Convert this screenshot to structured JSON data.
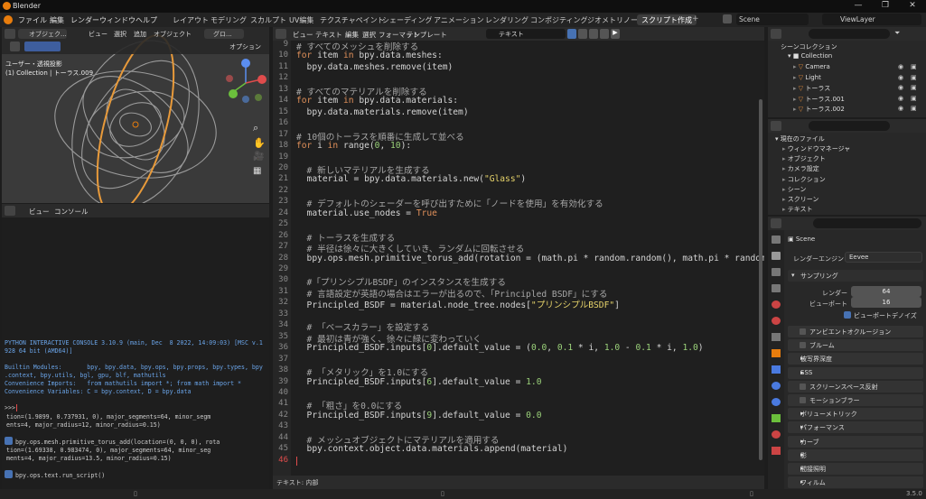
{
  "window": {
    "title": "Blender",
    "version": "3.5.0"
  },
  "menu": [
    "ファイル",
    "編集",
    "レンダー",
    "ウィンドウ",
    "ヘルプ"
  ],
  "workspaces": [
    "レイアウト",
    "モデリング",
    "スカルプト",
    "UV編集",
    "テクスチャペイント",
    "シェーディング",
    "アニメーション",
    "レンダリング",
    "コンポジティング",
    "ジオメトリノード",
    "スクリプト作成"
  ],
  "scene_selector": {
    "scene": "Scene",
    "viewlayer": "ViewLayer"
  },
  "viewport": {
    "mode": "オブジェク...",
    "menus": [
      "ビュー",
      "選択",
      "追加",
      "オブジェクト"
    ],
    "transform": "グロ...",
    "options": "オプション",
    "overlay_title": "ユーザー・透視投影",
    "overlay_sub": "(1) Collection | トーラス.009"
  },
  "console": {
    "menus": [
      "ビュー",
      "コンソール"
    ],
    "lines": [
      "PYTHON INTERACTIVE CONSOLE 3.10.9 (main, Dec  8 2022, 14:09:03) [MSC v.1",
      "928 64 bit (AMD64)]",
      "",
      "Builtin Modules:       bpy, bpy.data, bpy.ops, bpy.props, bpy.types, bpy",
      ".context, bpy.utils, bgl, gpu, blf, mathutils",
      "Convenience Imports:   from mathutils import *; from math import *",
      "Convenience Variables: C = bpy.context, D = bpy.data",
      "",
      ">>> "
    ],
    "history": [
      "tion=(1.9899, 0.737931, 0), major_segments=64, minor_segm",
      "ents=4, major_radius=12, minor_radius=0.15)",
      "bpy.ops.mesh.primitive_torus_add(location=(0, 0, 0), rota",
      "tion=(1.69338, 0.983474, 0), major_segments=64, minor_seg",
      "ments=4, major_radius=13.5, minor_radius=0.15)",
      "bpy.ops.text.run_script()"
    ]
  },
  "editor": {
    "menus": [
      "ビュー",
      "テキスト",
      "編集",
      "選択",
      "フォーマット",
      "テンプレート"
    ],
    "filename": "テキスト",
    "footer": "テキスト: 内部",
    "lines": [
      {
        "n": "9",
        "segs": [
          [
            "cm",
            "# すべてのメッシュを削除する"
          ]
        ]
      },
      {
        "n": "10",
        "segs": [
          [
            "kw",
            "for"
          ],
          [
            "",
            " item "
          ],
          [
            "kw",
            "in"
          ],
          [
            "",
            " bpy.data.meshes:"
          ]
        ]
      },
      {
        "n": "11",
        "segs": [
          [
            "",
            "  bpy.data.meshes.remove(item)"
          ]
        ]
      },
      {
        "n": "12",
        "segs": []
      },
      {
        "n": "13",
        "segs": [
          [
            "cm",
            "# すべてのマテリアルを削除する"
          ]
        ]
      },
      {
        "n": "14",
        "segs": [
          [
            "kw",
            "for"
          ],
          [
            "",
            " item "
          ],
          [
            "kw",
            "in"
          ],
          [
            "",
            " bpy.data.materials:"
          ]
        ]
      },
      {
        "n": "15",
        "segs": [
          [
            "",
            "  bpy.data.materials.remove(item)"
          ]
        ]
      },
      {
        "n": "16",
        "segs": []
      },
      {
        "n": "17",
        "segs": [
          [
            "cm",
            "# 10個のトーラスを順番に生成して並べる"
          ]
        ]
      },
      {
        "n": "18",
        "segs": [
          [
            "kw",
            "for"
          ],
          [
            "",
            " i "
          ],
          [
            "kw",
            "in"
          ],
          [
            "",
            " range("
          ],
          [
            "nu",
            "0"
          ],
          [
            "",
            ", "
          ],
          [
            "nu",
            "10"
          ],
          [
            "",
            "):"
          ]
        ]
      },
      {
        "n": "19",
        "segs": []
      },
      {
        "n": "20",
        "segs": [
          [
            "cm",
            "  # 新しいマテリアルを生成する"
          ]
        ]
      },
      {
        "n": "21",
        "segs": [
          [
            "",
            "  material = bpy.data.materials.new("
          ],
          [
            "st",
            "\"Glass\""
          ],
          [
            "",
            ")"
          ]
        ]
      },
      {
        "n": "22",
        "segs": []
      },
      {
        "n": "23",
        "segs": [
          [
            "cm",
            "  # デフォルトのシェーダーを呼び出すために「ノードを使用」を有効化する"
          ]
        ]
      },
      {
        "n": "24",
        "segs": [
          [
            "",
            "  material.use_nodes = "
          ],
          [
            "kw",
            "True"
          ]
        ]
      },
      {
        "n": "25",
        "segs": []
      },
      {
        "n": "26",
        "segs": [
          [
            "cm",
            "  # トーラスを生成する"
          ]
        ]
      },
      {
        "n": "27",
        "segs": [
          [
            "cm",
            "  # 半径は徐々に大きくしていき、ランダムに回転させる"
          ]
        ]
      },
      {
        "n": "28",
        "segs": [
          [
            "",
            "  bpy.ops.mesh.primitive_torus_add(rotation = (math.pi * random.random(), math.pi * random."
          ]
        ]
      },
      {
        "n": "29",
        "segs": []
      },
      {
        "n": "30",
        "segs": [
          [
            "cm",
            "  #「プリンシプルBSDF」のインスタンスを生成する"
          ]
        ]
      },
      {
        "n": "31",
        "segs": [
          [
            "cm",
            "  # 言語設定が英語の場合はエラーが出るので、「Principled BSDF」にする"
          ]
        ]
      },
      {
        "n": "32",
        "segs": [
          [
            "",
            "  Principled_BSDF = material.node_tree.nodes["
          ],
          [
            "st",
            "\"プリンシプルBSDF\""
          ],
          [
            "",
            "]"
          ]
        ]
      },
      {
        "n": "33",
        "segs": []
      },
      {
        "n": "34",
        "segs": [
          [
            "cm",
            "  # 「ベースカラー」を設定する"
          ]
        ]
      },
      {
        "n": "35",
        "segs": [
          [
            "cm",
            "  # 最初は青が強く、徐々に緑に変わっていく"
          ]
        ]
      },
      {
        "n": "36",
        "segs": [
          [
            "",
            "  Principled_BSDF.inputs["
          ],
          [
            "nu",
            "0"
          ],
          [
            "",
            "].default_value = ("
          ],
          [
            "nu",
            "0.0"
          ],
          [
            "",
            ", "
          ],
          [
            "nu",
            "0.1"
          ],
          [
            "",
            " * i, "
          ],
          [
            "nu",
            "1.0"
          ],
          [
            "",
            " - "
          ],
          [
            "nu",
            "0.1"
          ],
          [
            "",
            " * i, "
          ],
          [
            "nu",
            "1.0"
          ],
          [
            "",
            ")"
          ]
        ]
      },
      {
        "n": "37",
        "segs": []
      },
      {
        "n": "38",
        "segs": [
          [
            "cm",
            "  # 「メタリック」を1.0にする"
          ]
        ]
      },
      {
        "n": "39",
        "segs": [
          [
            "",
            "  Principled_BSDF.inputs["
          ],
          [
            "nu",
            "6"
          ],
          [
            "",
            "].default_value = "
          ],
          [
            "nu",
            "1.0"
          ]
        ]
      },
      {
        "n": "40",
        "segs": []
      },
      {
        "n": "41",
        "segs": [
          [
            "cm",
            "  # 「粗さ」を0.0にする"
          ]
        ]
      },
      {
        "n": "42",
        "segs": [
          [
            "",
            "  Principled_BSDF.inputs["
          ],
          [
            "nu",
            "9"
          ],
          [
            "",
            "].default_value = "
          ],
          [
            "nu",
            "0.0"
          ]
        ]
      },
      {
        "n": "43",
        "segs": []
      },
      {
        "n": "44",
        "segs": [
          [
            "cm",
            "  # メッシュオブジェクトにマテリアルを適用する"
          ]
        ]
      },
      {
        "n": "45",
        "segs": [
          [
            "",
            "  bpy.context.object.data.materials.append(material)"
          ]
        ]
      },
      {
        "n": "46",
        "segs": []
      }
    ]
  },
  "outliner": {
    "root": "シーンコレクション",
    "collection": "Collection",
    "items": [
      "Camera",
      "Light",
      "トーラス",
      "トーラス.001",
      "トーラス.002"
    ]
  },
  "fileview": {
    "root": "現在のファイル",
    "items": [
      "ウィンドウマネージャ",
      "オブジェクト",
      "カメラ設定",
      "コレクション",
      "シーン",
      "スクリーン",
      "テキスト"
    ]
  },
  "properties": {
    "scene": "Scene",
    "engine_label": "レンダーエンジン",
    "engine": "Eevee",
    "sampling": "サンプリング",
    "render_label": "レンダー",
    "render_value": "64",
    "viewport_label": "ビューポート",
    "viewport_value": "16",
    "denoise_label": "ビューポートデノイズ",
    "panels": [
      "アンビエントオクルージョン",
      "ブルーム",
      "被写界深度",
      "SSS",
      "スクリーンスペース反射",
      "モーションブラー",
      "ボリューメトリック",
      "パフォーマンス",
      "カーブ",
      "影",
      "間接照明",
      "フィルム"
    ],
    "panel_has_checkbox": [
      true,
      true,
      false,
      false,
      true,
      true,
      false,
      false,
      false,
      false,
      false,
      false
    ]
  },
  "colors": {
    "accent": "#e87d0d",
    "active_tab": "#3d3d3d",
    "keyword": "#e0905a",
    "string": "#e6d36a",
    "number": "#9bd27a"
  }
}
